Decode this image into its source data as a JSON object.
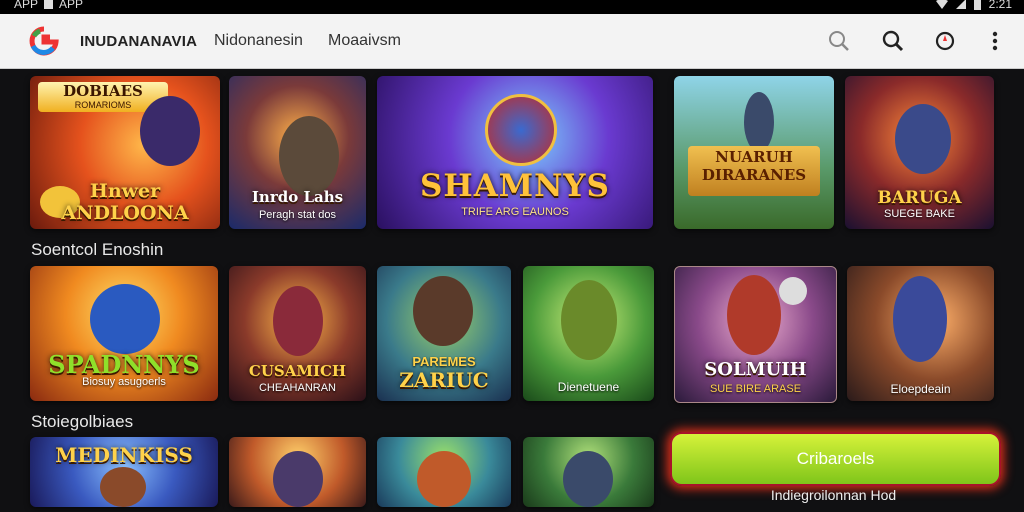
{
  "status": {
    "left_text_1": "APP",
    "left_text_2": "APP",
    "time": "2:21"
  },
  "appbar": {
    "title": "INUDANANAVIA",
    "tabs": [
      "Nidonanesin",
      "Moaaivsm"
    ]
  },
  "sections": [
    "Soentcol Enoshin",
    "Stoiegolbiaes"
  ],
  "row1": [
    {
      "title": "Hnwer ANDLOONA",
      "banner": "DOBIAES",
      "banner_sub": "ROMARIOMS",
      "badge": ""
    },
    {
      "title": "Inrdo Lahs",
      "sub": "Peragh stat dos",
      "badge": ""
    },
    {
      "title": "SHAMNYS",
      "sub": "TRIFE ARG EAUNOS"
    },
    {
      "title": "NUARUH DIRARANES"
    },
    {
      "title": "BARUGA",
      "sub": "SUEGE BAKE"
    }
  ],
  "row2": [
    {
      "title": "SPADNNYS",
      "sub": "Biosuy asugoerls"
    },
    {
      "title": "CUSAMICH",
      "sub": "CHEAHANRAN"
    },
    {
      "title": "ZARIUC",
      "sub": "PAREMES"
    },
    {
      "title": "Dienetuene"
    },
    {
      "title": "SOLMUIH",
      "sub": "SUE BIRE ARASE"
    },
    {
      "title": "Eloepdeain"
    }
  ],
  "row3": [
    {
      "title": "MEDINKISS"
    },
    {
      "title": ""
    },
    {
      "title": ""
    },
    {
      "title": ""
    }
  ],
  "cta": {
    "label": "Cribaroels",
    "caption": "Indiegroilonnan Hod"
  },
  "colors": {
    "accent": "#8fd11f",
    "cta_glow": "#d62e1a"
  }
}
